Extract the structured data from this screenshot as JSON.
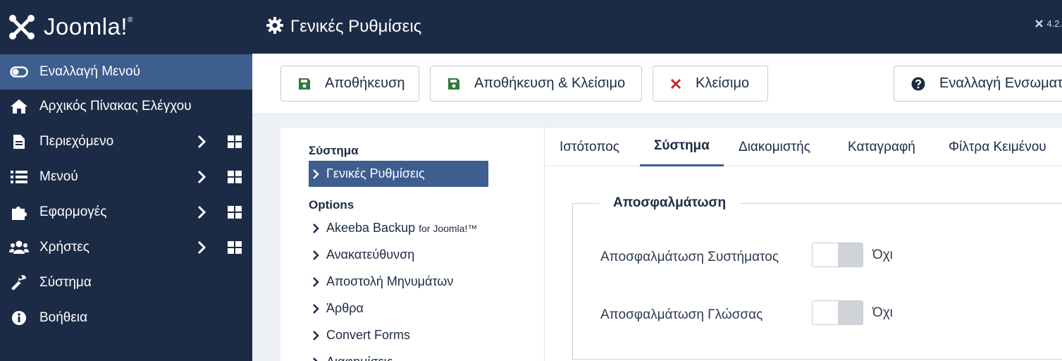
{
  "brand": {
    "name": "Joomla!",
    "trademark": "®"
  },
  "header": {
    "title": "Γενικές Ρυθμίσεις",
    "version": "4.2."
  },
  "sidebar": {
    "items": [
      {
        "label": "Εναλλαγή Μενού",
        "icon": "toggle-icon"
      },
      {
        "label": "Αρχικός Πίνακας Ελέγχου",
        "icon": "home-icon"
      },
      {
        "label": "Περιεχόμενο",
        "icon": "file-icon"
      },
      {
        "label": "Μενού",
        "icon": "list-icon"
      },
      {
        "label": "Εφαρμογές",
        "icon": "puzzle-icon"
      },
      {
        "label": "Χρήστες",
        "icon": "users-icon"
      },
      {
        "label": "Σύστημα",
        "icon": "wrench-icon"
      },
      {
        "label": "Βοήθεια",
        "icon": "info-icon"
      }
    ]
  },
  "toolbar": {
    "save": "Αποθήκευση",
    "save_close": "Αποθήκευση & Κλείσιμο",
    "close": "Κλείσιμο",
    "help": "Εναλλαγή Ενσωματ"
  },
  "leftnav": {
    "system_heading": "Σύστημα",
    "system_items": [
      "Γενικές Ρυθμίσεις"
    ],
    "options_heading": "Options",
    "options_items": [
      {
        "label": "Akeeba Backup",
        "suffix": "for Joomla!™"
      },
      {
        "label": "Ανακατεύθυνση"
      },
      {
        "label": "Αποστολή Μηνυμάτων"
      },
      {
        "label": "Άρθρα"
      },
      {
        "label": "Convert Forms"
      },
      {
        "label": "Διαφημίσεις"
      }
    ]
  },
  "tabs": [
    "Ιστότοπος",
    "Σύστημα",
    "Διακομιστής",
    "Καταγραφή",
    "Φίλτρα Κειμένου"
  ],
  "active_tab": "Σύστημα",
  "debug": {
    "legend": "Αποσφαλμάτωση",
    "fields": [
      {
        "label": "Αποσφαλμάτωση Συστήματος",
        "value": "Όχι"
      },
      {
        "label": "Αποσφαλμάτωση Γλώσσας",
        "value": "Όχι"
      }
    ]
  },
  "colors": {
    "sidebar_bg": "#1c2b45",
    "accent": "#3d5e8e",
    "save_green": "#2f7a3a",
    "close_red": "#c52827"
  }
}
